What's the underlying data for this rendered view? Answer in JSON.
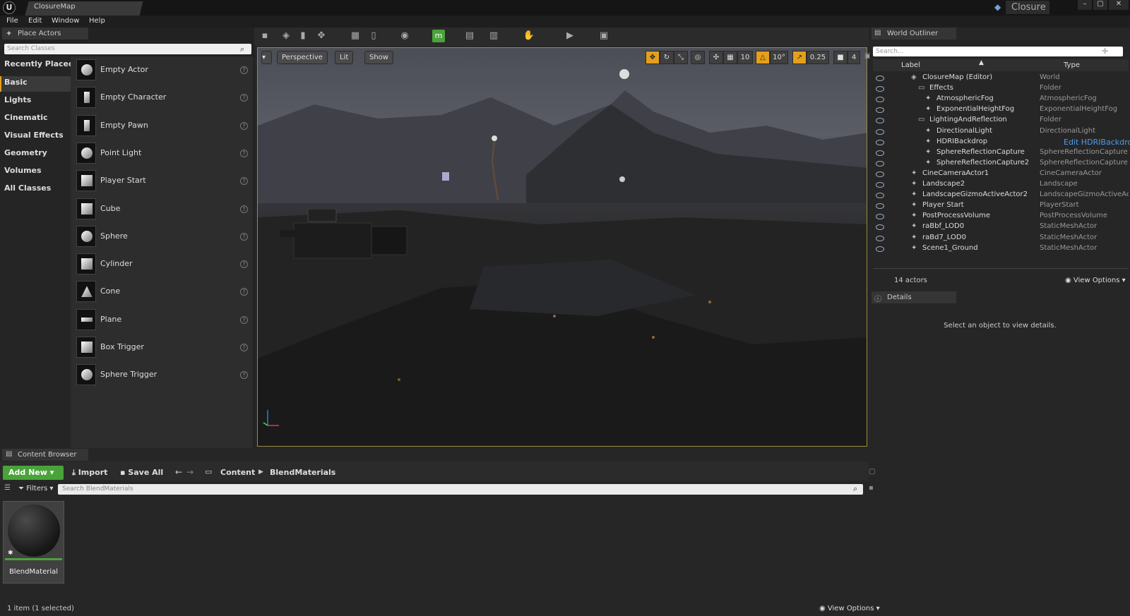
{
  "window": {
    "tab_title": "ClosureMap",
    "project_name": "Closure",
    "minimize": "–",
    "maximize": "▢",
    "close": "✕"
  },
  "menu": [
    "File",
    "Edit",
    "Window",
    "Help"
  ],
  "place_actors": {
    "tab_title": "Place Actors",
    "search_placeholder": "Search Classes",
    "categories": [
      "Recently Placed",
      "Basic",
      "Lights",
      "Cinematic",
      "Visual Effects",
      "Geometry",
      "Volumes",
      "All Classes"
    ],
    "items": [
      "Empty Actor",
      "Empty Character",
      "Empty Pawn",
      "Point Light",
      "Player Start",
      "Cube",
      "Sphere",
      "Cylinder",
      "Cone",
      "Plane",
      "Box Trigger",
      "Sphere Trigger"
    ],
    "help": "?"
  },
  "viewport": {
    "perspective": "Perspective",
    "lit": "Lit",
    "show": "Show",
    "grid_snap": "10",
    "rot_snap": "10°",
    "scale_snap": "0.25",
    "cam_speed": "4"
  },
  "outliner": {
    "tab_title": "World Outliner",
    "search_placeholder": "Search...",
    "col_label": "Label",
    "col_type": "Type",
    "rows": [
      {
        "label": "ClosureMap (Editor)",
        "type": "World"
      },
      {
        "label": "Effects",
        "type": "Folder"
      },
      {
        "label": "AtmosphericFog",
        "type": "AtmosphericFog"
      },
      {
        "label": "ExponentialHeightFog",
        "type": "ExponentialHeightFog"
      },
      {
        "label": "LightingAndReflection",
        "type": "Folder"
      },
      {
        "label": "DirectionalLight",
        "type": "DirectionalLight"
      },
      {
        "label": "HDRIBackdrop",
        "type": "Edit HDRIBackdrop"
      },
      {
        "label": "SphereReflectionCapture",
        "type": "SphereReflectionCapture"
      },
      {
        "label": "SphereReflectionCapture2",
        "type": "SphereReflectionCapture"
      },
      {
        "label": "CineCameraActor1",
        "type": "CineCameraActor"
      },
      {
        "label": "Landscape2",
        "type": "Landscape"
      },
      {
        "label": "LandscapeGizmoActiveActor2",
        "type": "LandscapeGizmoActiveActor"
      },
      {
        "label": "Player Start",
        "type": "PlayerStart"
      },
      {
        "label": "PostProcessVolume",
        "type": "PostProcessVolume"
      },
      {
        "label": "raBbf_LOD0",
        "type": "StaticMeshActor"
      },
      {
        "label": "raBd7_LOD0",
        "type": "StaticMeshActor"
      },
      {
        "label": "Scene1_Ground",
        "type": "StaticMeshActor"
      }
    ],
    "actor_count": "14 actors",
    "view_options": "View Options"
  },
  "details": {
    "tab_title": "Details",
    "empty_msg": "Select an object to view details."
  },
  "content_browser": {
    "tab_title": "Content Browser",
    "add_new": "Add New",
    "import": "Import",
    "save_all": "Save All",
    "path": [
      "Content",
      "BlendMaterials"
    ],
    "filters": "Filters",
    "search_placeholder": "Search BlendMaterials",
    "asset_name": "BlendMaterial",
    "status": "1 item (1 selected)",
    "view_options": "View Options"
  },
  "colors": {
    "accent": "#e5a01b",
    "add_new": "#4aa33a",
    "link": "#4f9be8"
  }
}
